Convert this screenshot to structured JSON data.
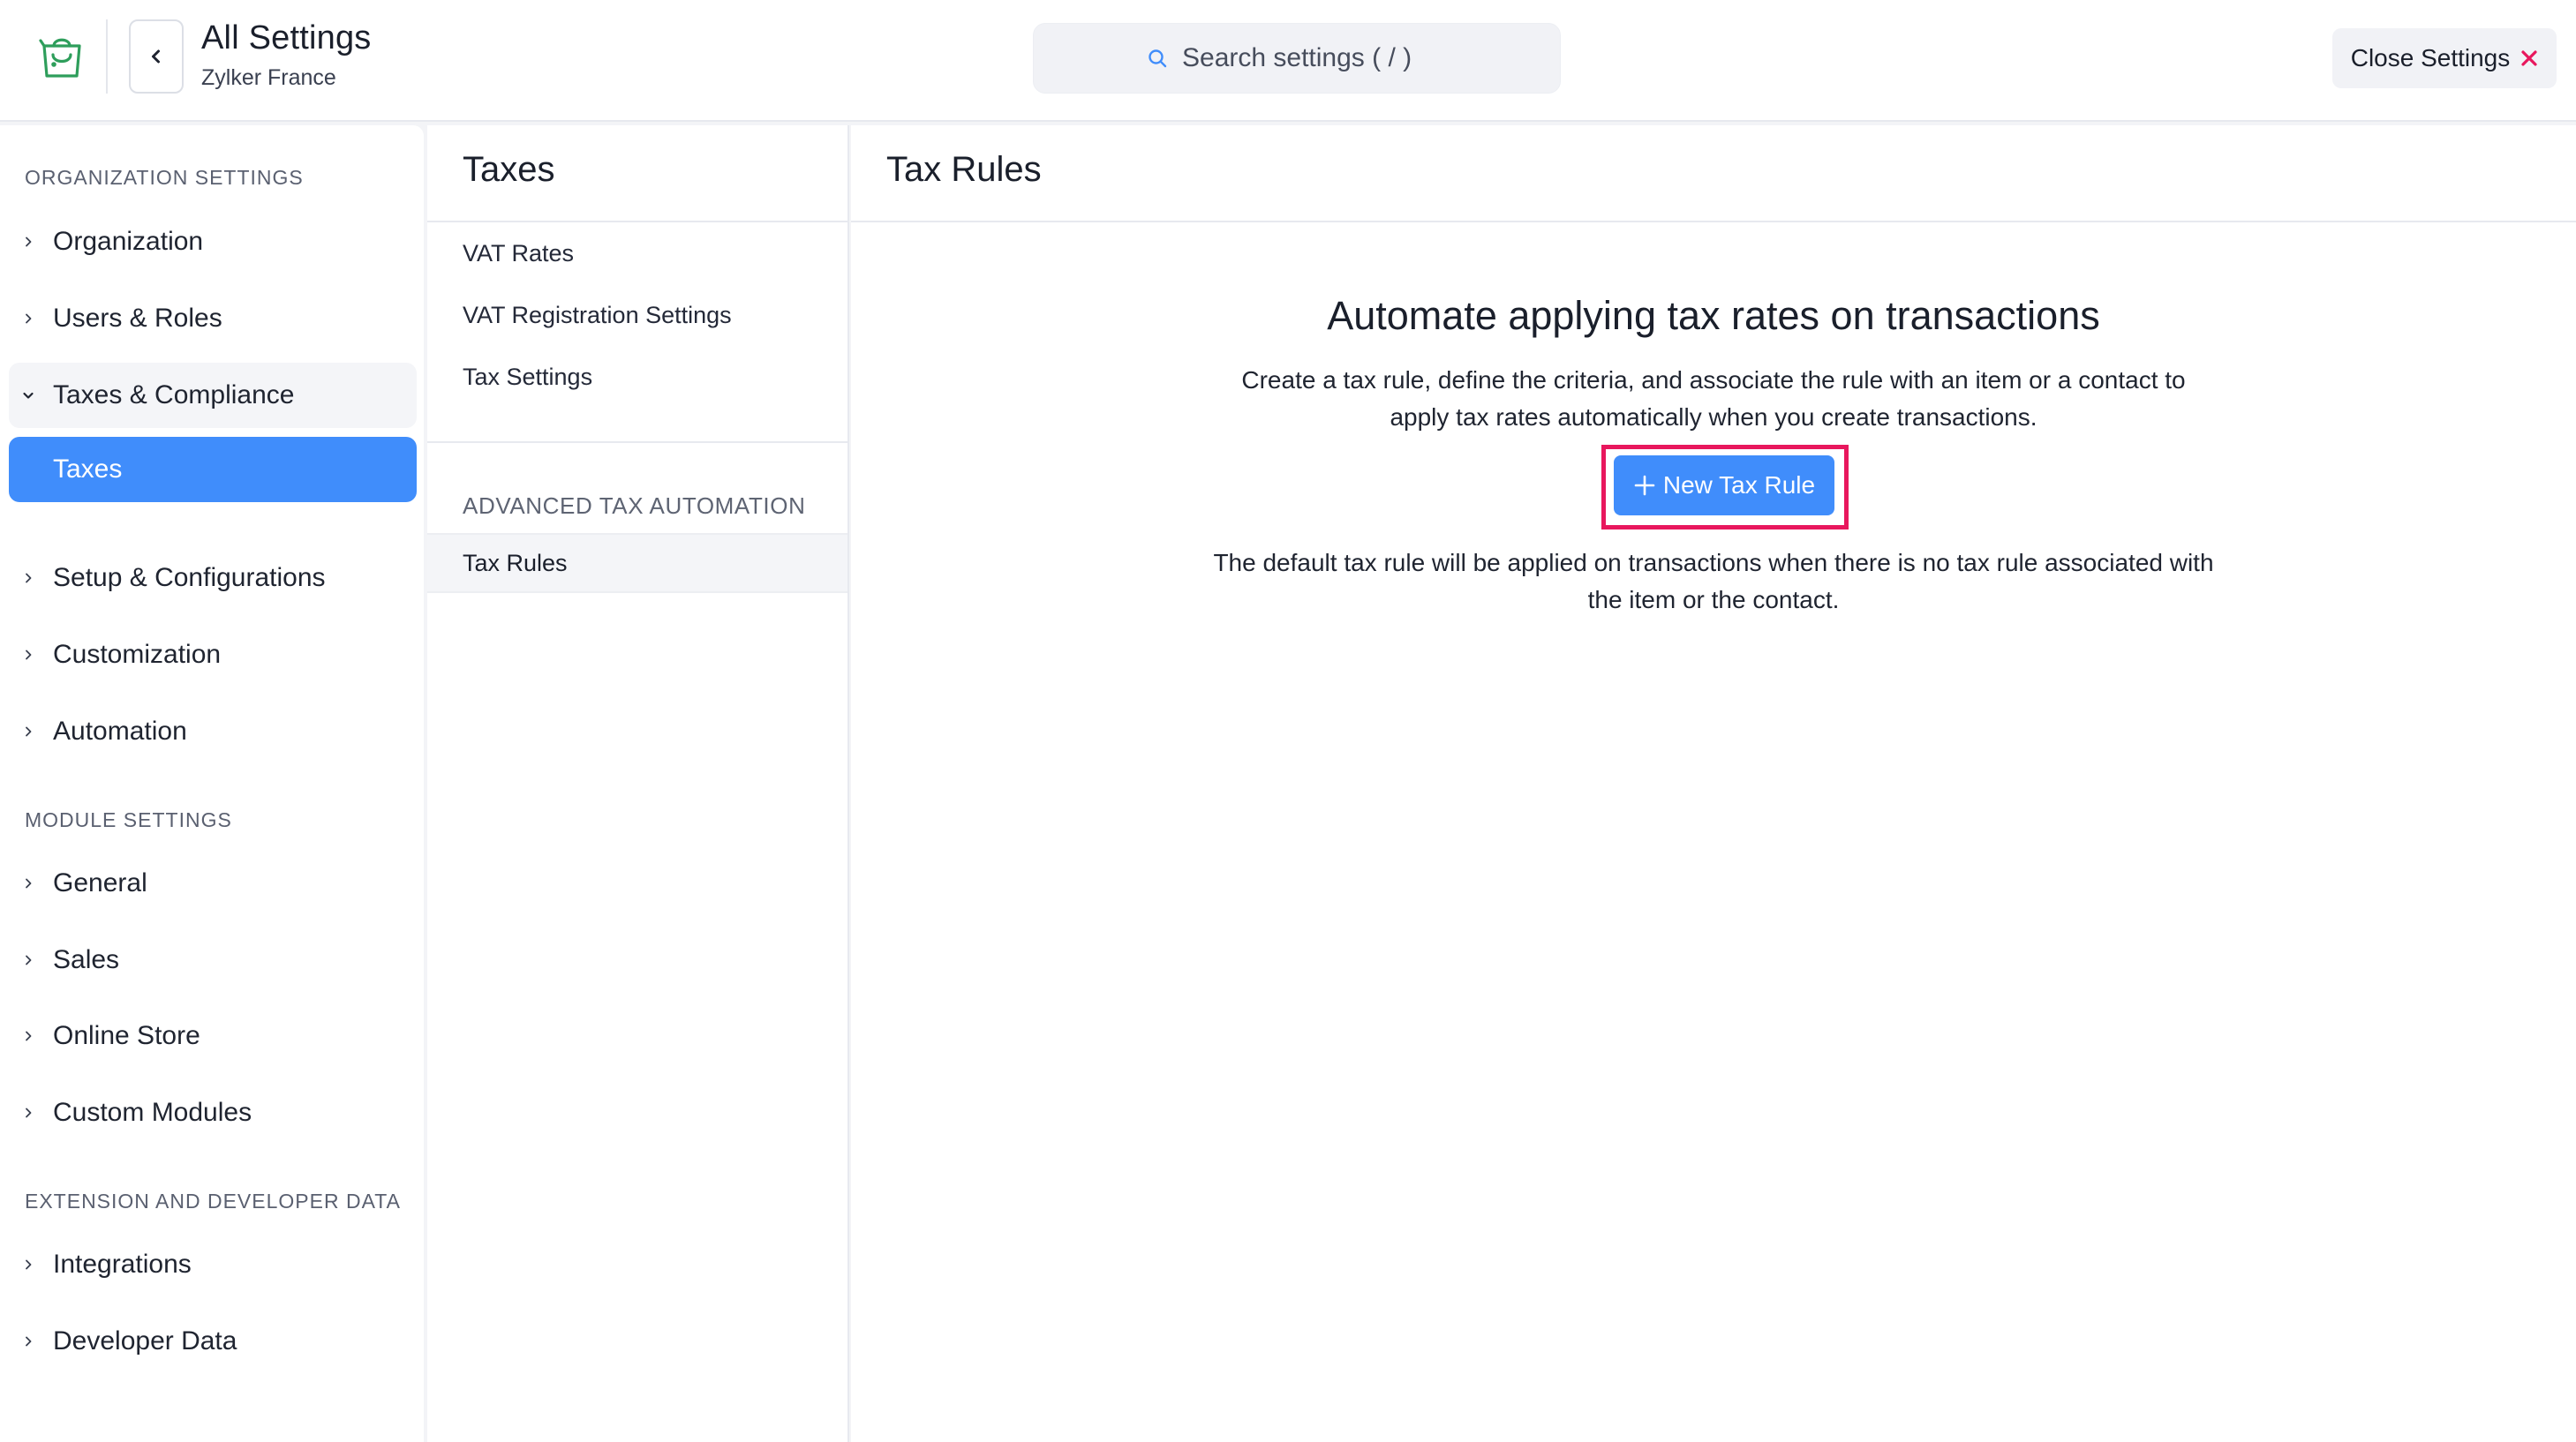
{
  "header": {
    "app_title": "All Settings",
    "org_name": "Zylker France",
    "search_placeholder": "Search settings ( / )",
    "close_label": "Close Settings"
  },
  "sidebar": {
    "sections": [
      {
        "heading": "ORGANIZATION SETTINGS",
        "items": [
          {
            "label": "Organization"
          },
          {
            "label": "Users & Roles"
          },
          {
            "label": "Taxes & Compliance",
            "expanded": true,
            "children": [
              {
                "label": "Taxes",
                "active": true
              }
            ]
          },
          {
            "label": "Setup & Configurations"
          },
          {
            "label": "Customization"
          },
          {
            "label": "Automation"
          }
        ]
      },
      {
        "heading": "MODULE SETTINGS",
        "items": [
          {
            "label": "General"
          },
          {
            "label": "Sales"
          },
          {
            "label": "Online Store"
          },
          {
            "label": "Custom Modules"
          }
        ]
      },
      {
        "heading": "EXTENSION AND DEVELOPER DATA",
        "items": [
          {
            "label": "Integrations"
          },
          {
            "label": "Developer Data"
          }
        ]
      }
    ]
  },
  "middle": {
    "title": "Taxes",
    "links": [
      {
        "label": "VAT Rates"
      },
      {
        "label": "VAT Registration Settings"
      },
      {
        "label": "Tax Settings"
      }
    ],
    "section_heading": "ADVANCED TAX AUTOMATION",
    "active_link": "Tax Rules"
  },
  "main": {
    "title": "Tax Rules",
    "empty_heading": "Automate applying tax rates on transactions",
    "empty_description": "Create a tax rule, define the criteria, and associate the rule with an item or a contact to apply tax rates automatically when you create transactions.",
    "new_button_label": "New Tax Rule",
    "note": "The default tax rule will be applied on transactions when there is no tax rule associated with the item or the contact."
  },
  "colors": {
    "accent": "#408dfb",
    "highlight": "#e8175d",
    "close_x": "#e8175d",
    "logo": "#2e9e5b"
  }
}
